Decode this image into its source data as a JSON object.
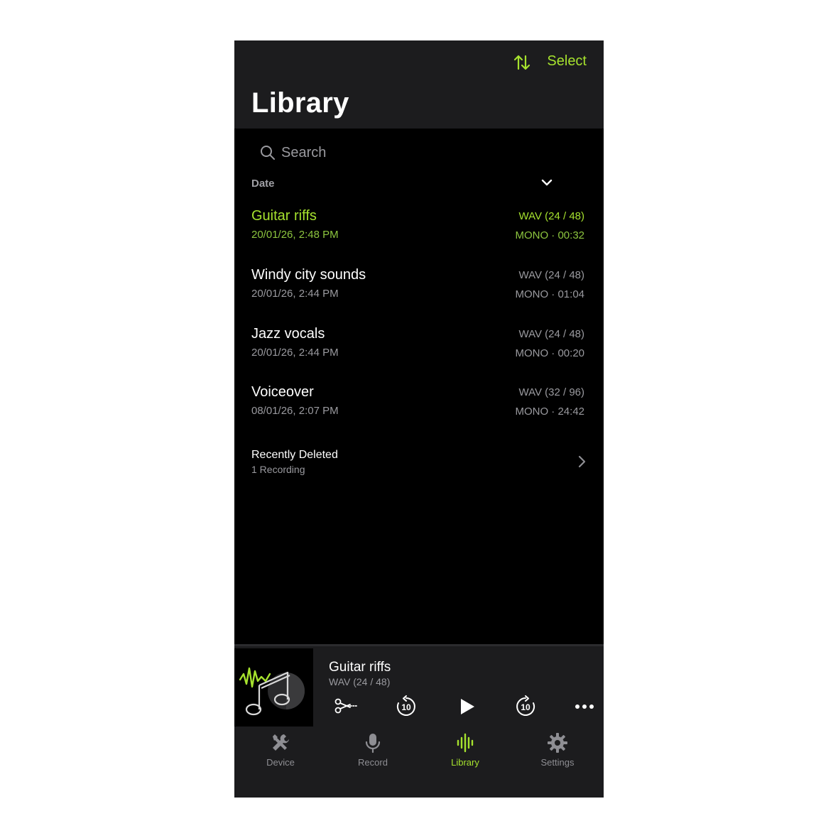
{
  "header": {
    "title": "Library",
    "select_label": "Select",
    "sort_icon": "sort-arrows-icon"
  },
  "search": {
    "placeholder": "Search"
  },
  "list": {
    "section_label": "Date",
    "items": [
      {
        "name": "Guitar riffs",
        "date": "20/01/26, 2:48 PM",
        "format": "WAV (24 / 48)",
        "meta": "MONO · 00:32",
        "active": true
      },
      {
        "name": "Windy city sounds",
        "date": "20/01/26, 2:44 PM",
        "format": "WAV (24 / 48)",
        "meta": "MONO · 01:04",
        "active": false
      },
      {
        "name": "Jazz vocals",
        "date": "20/01/26, 2:44 PM",
        "format": "WAV (24 / 48)",
        "meta": "MONO · 00:20",
        "active": false
      },
      {
        "name": "Voiceover",
        "date": "08/01/26, 2:07 PM",
        "format": "WAV (32 / 96)",
        "meta": "MONO · 24:42",
        "active": false
      }
    ],
    "recently_deleted": {
      "title": "Recently Deleted",
      "subtitle": "1 Recording"
    }
  },
  "now_playing": {
    "title": "Guitar riffs",
    "format": "WAV (24 / 48)",
    "skip_back_label": "10",
    "skip_forward_label": "10"
  },
  "tabs": [
    {
      "label": "Device",
      "icon": "tools-icon",
      "active": false
    },
    {
      "label": "Record",
      "icon": "microphone-icon",
      "active": false
    },
    {
      "label": "Library",
      "icon": "waveform-icon",
      "active": true
    },
    {
      "label": "Settings",
      "icon": "gear-icon",
      "active": false
    }
  ],
  "colors": {
    "accent": "#a6e22e",
    "background": "#000000",
    "surface": "#1c1c1e",
    "secondary_text": "#9a9a9f"
  }
}
